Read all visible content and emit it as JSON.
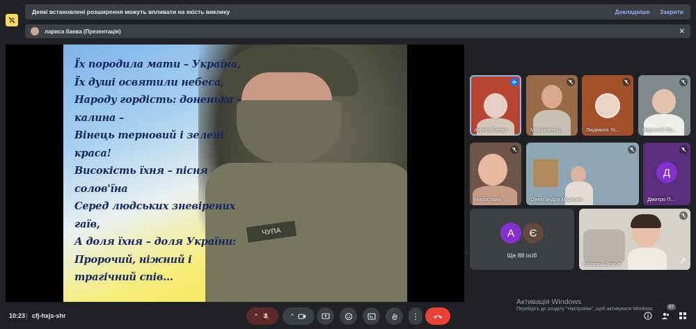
{
  "warning": {
    "message": "Деякі встановлені розширення можуть впливати на якість виклику",
    "details_label": "Докладніше",
    "close_label": "Закрити"
  },
  "presenting": {
    "label": "лариса баева (Презентація)"
  },
  "slide": {
    "lines": [
      "Їх породила мати – Україна,",
      "Їх душі освятили небеса,",
      "Народу гордість: доненька –",
      "калина –",
      "Вінець терновий і зелені",
      "краса!",
      "Високість їхня – пісня",
      "солов'їна",
      "Серед людських зневірених",
      "гаїв,",
      "А доля їхня – доля України:",
      "Пророчий, ніжний і",
      "трагічний спів..."
    ],
    "patch_text": "ЧУПА"
  },
  "participants": [
    {
      "name": "лариса баева",
      "speaking": true
    },
    {
      "name": "Михайленко...",
      "speaking": false
    },
    {
      "name": "Людмила Ус...",
      "speaking": false
    },
    {
      "name": "Надточій Ол...",
      "speaking": false
    },
    {
      "name": "Мирослава ...",
      "speaking": false
    },
    {
      "name": "Олександра Маркова",
      "speaking": false
    },
    {
      "name": "Дмитро П...",
      "initial": "Д",
      "speaking": false
    },
    {
      "name": "Варвара Дем'ів",
      "speaking": false
    }
  ],
  "others": {
    "initials": [
      "А",
      "Є"
    ],
    "label": "Ще 88 осіб"
  },
  "footer": {
    "time": "10:23",
    "separator": "|",
    "meeting_code": "cfj-hxjs-shr",
    "participants_count": "97"
  },
  "activation": {
    "title": "Активація Windows",
    "subtitle": "Перейдіть до розділу \"Настройки\", щоб активувати Windows."
  },
  "colors": {
    "background": "#202124",
    "tile": "#3c4043",
    "link": "#8ab4f8",
    "end_call": "#ea4335",
    "warn_icon": "#fdd663",
    "avatar_purple": "#8430ce"
  }
}
